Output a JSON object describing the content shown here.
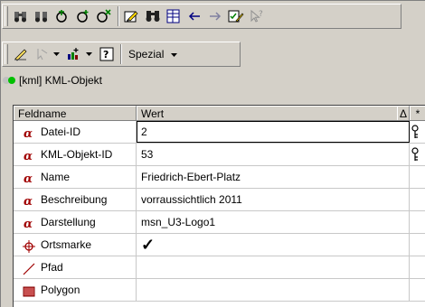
{
  "toolbar2": {
    "spezial_label": "Spezial"
  },
  "object": {
    "label": "[kml] KML-Objekt",
    "status_colors": [
      "#c0c0c0",
      "#00c000"
    ]
  },
  "grid": {
    "headers": [
      "Feldname",
      "Wert",
      "Δ",
      "*"
    ],
    "rows": [
      {
        "name": "Datei-ID",
        "value": "2",
        "icon": "alpha-icon"
      },
      {
        "name": "KML-Objekt-ID",
        "value": "53",
        "icon": "alpha-icon"
      },
      {
        "name": "Name",
        "value": "Friedrich-Ebert-Platz",
        "icon": "alpha-icon"
      },
      {
        "name": "Beschreibung",
        "value": "vorraussichtlich 2011",
        "icon": "alpha-icon"
      },
      {
        "name": "Darstellung",
        "value": "msn_U3-Logo1",
        "icon": "alpha-icon"
      },
      {
        "name": "Ortsmarke",
        "value": "✓",
        "icon": "crosshair-icon"
      },
      {
        "name": "Pfad",
        "value": "",
        "icon": "line-icon"
      },
      {
        "name": "Polygon",
        "value": "",
        "icon": "polygon-icon"
      }
    ]
  },
  "colors": {
    "face": "#d4d0c8",
    "alpha_red": "#a00000"
  }
}
